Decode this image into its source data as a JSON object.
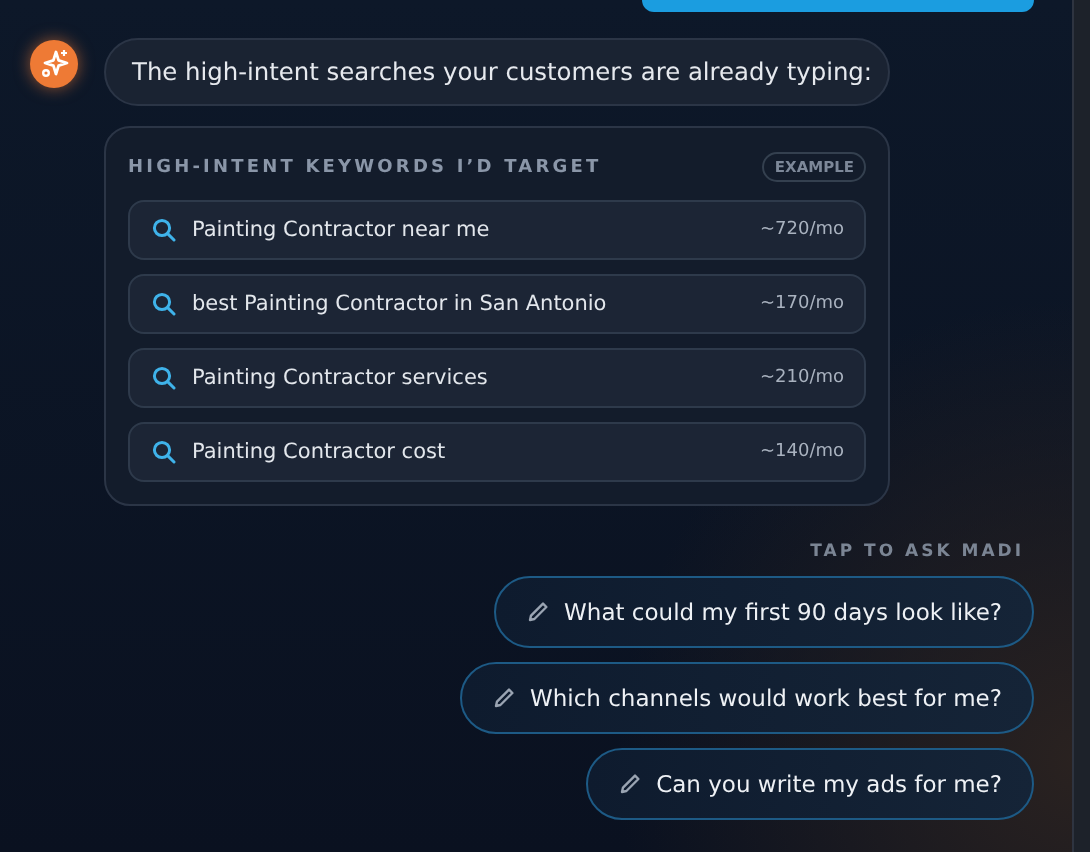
{
  "assistant_message": "The high-intent searches your customers are already typing:",
  "keywords_card": {
    "title": "HIGH-INTENT KEYWORDS I’D TARGET",
    "badge": "EXAMPLE",
    "keywords": [
      {
        "term": "Painting Contractor near me",
        "volume": "~720/mo"
      },
      {
        "term": "best Painting Contractor in San Antonio",
        "volume": "~170/mo"
      },
      {
        "term": "Painting Contractor services",
        "volume": "~210/mo"
      },
      {
        "term": "Painting Contractor cost",
        "volume": "~140/mo"
      }
    ]
  },
  "suggestions_label": "TAP TO ASK MADI",
  "suggestions": [
    "What could my first 90 days look like?",
    "Which channels would work best for me?",
    "Can you write my ads for me?"
  ]
}
